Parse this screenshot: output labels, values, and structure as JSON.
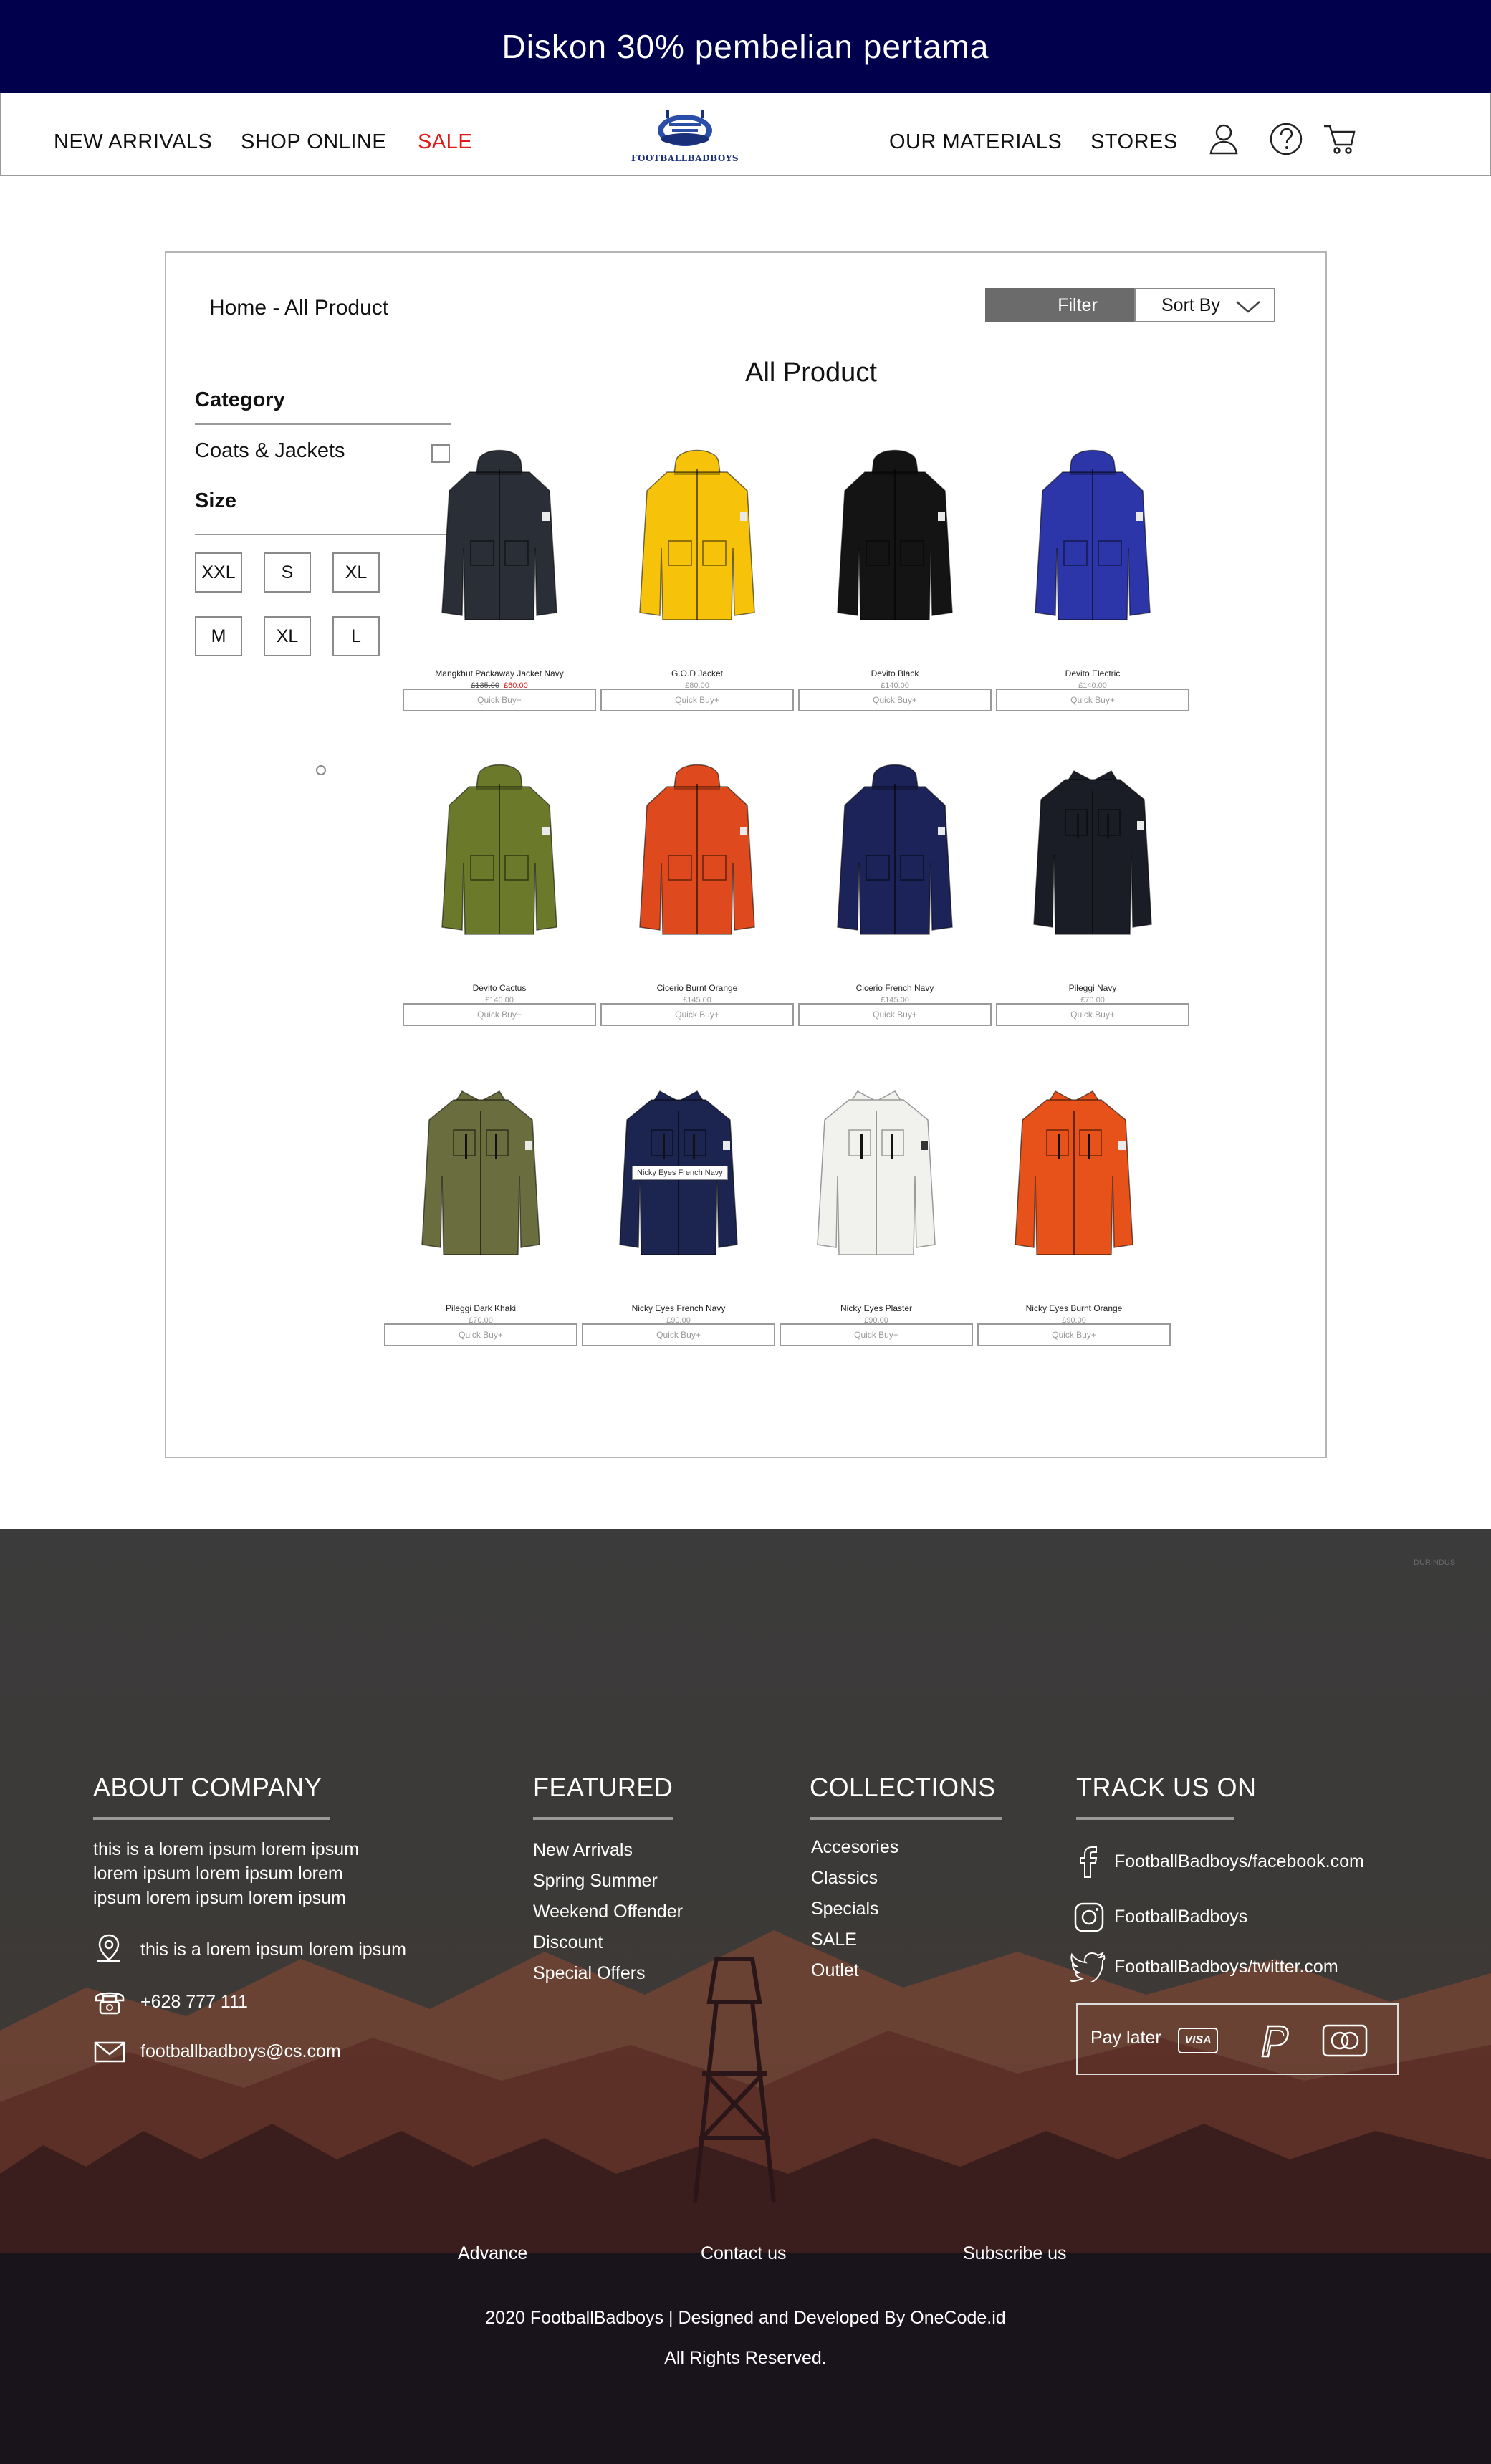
{
  "promo": {
    "text": "Diskon 30% pembelian pertama"
  },
  "nav": {
    "left": [
      "NEW ARRIVALS",
      "SHOP ONLINE",
      "SALE"
    ],
    "right": [
      "OUR MATERIALS",
      "STORES"
    ],
    "logo_text": "FOOTBALLBADBOYS",
    "icons": [
      "user-icon",
      "help-icon",
      "cart-icon"
    ],
    "sale_color": "#e01a1a"
  },
  "catalog": {
    "breadcrumb": "Home - All Product",
    "filter_label": "Filter",
    "sort_label": "Sort By",
    "title": "All Product",
    "category_heading": "Category",
    "category_item": "Coats & Jackets",
    "size_heading": "Size",
    "sizes": [
      "XXL",
      "S",
      "XL",
      "M",
      "XL",
      "L"
    ],
    "quick_buy": "Quick Buy+",
    "tooltip": "Nicky Eyes French Navy",
    "products": [
      {
        "name": "Mangkhut Packaway Jacket Navy",
        "old_price": "£135.00",
        "price": "£60.00",
        "color": "#2a2e36",
        "style": "hood"
      },
      {
        "name": "G.O.D Jacket",
        "price": "£80.00",
        "color": "#f6c30a",
        "style": "hood"
      },
      {
        "name": "Devito Black",
        "price": "£140.00",
        "color": "#141414",
        "style": "hood"
      },
      {
        "name": "Devito Electric",
        "price": "£140.00",
        "color": "#2d36a8",
        "style": "hood"
      },
      {
        "name": "Devito Cactus",
        "price": "£140.00",
        "color": "#6b7a2a",
        "style": "hood"
      },
      {
        "name": "Cicerio Burnt Orange",
        "price": "£145.00",
        "color": "#de4a1e",
        "style": "hood"
      },
      {
        "name": "Cicerio French Navy",
        "price": "£145.00",
        "color": "#1c2358",
        "style": "hood"
      },
      {
        "name": "Pileggi Navy",
        "price": "£70.00",
        "color": "#1a1d26",
        "style": "collar"
      },
      {
        "name": "Pileggi Dark Khaki",
        "price": "£70.00",
        "color": "#6a6e3f",
        "style": "collar"
      },
      {
        "name": "Nicky Eyes French Navy",
        "price": "£90.00",
        "color": "#1c2450",
        "style": "collar"
      },
      {
        "name": "Nicky Eyes Plaster",
        "price": "£90.00",
        "color": "#f1f1ee",
        "style": "collar"
      },
      {
        "name": "Nicky Eyes Burnt Orange",
        "price": "£90.00",
        "color": "#e6521a",
        "style": "collar"
      }
    ]
  },
  "footer": {
    "tiny_tag": "DURINDUS",
    "about": {
      "heading": "ABOUT COMPANY",
      "text_lines": [
        "this is a lorem ipsum lorem ipsum",
        "lorem ipsum lorem ipsum lorem",
        "ipsum lorem ipsum lorem ipsum"
      ],
      "address": "this is a lorem ipsum lorem ipsum",
      "phone": "+628 777 111",
      "email": "footballbadboys@cs.com"
    },
    "featured": {
      "heading": "FEATURED",
      "items": [
        "New Arrivals",
        "Spring Summer",
        "Weekend Offender",
        "Discount",
        "Special Offers"
      ]
    },
    "collections": {
      "heading": "COLLECTIONS",
      "items": [
        "Accesories",
        "Classics",
        "Specials",
        "SALE",
        "Outlet"
      ]
    },
    "track": {
      "heading": "TRACK US ON",
      "facebook": "FootballBadboys/facebook.com",
      "instagram": "FootballBadboys",
      "twitter": "FootballBadboys/twitter.com",
      "pay_later": "Pay later",
      "visa": "VISA"
    },
    "bottom_links": [
      "Advance",
      "Contact us",
      "Subscribe us"
    ],
    "copyright": "2020 FootballBadboys | Designed and Developed By OneCode.id",
    "rights": "All Rights Reserved."
  }
}
